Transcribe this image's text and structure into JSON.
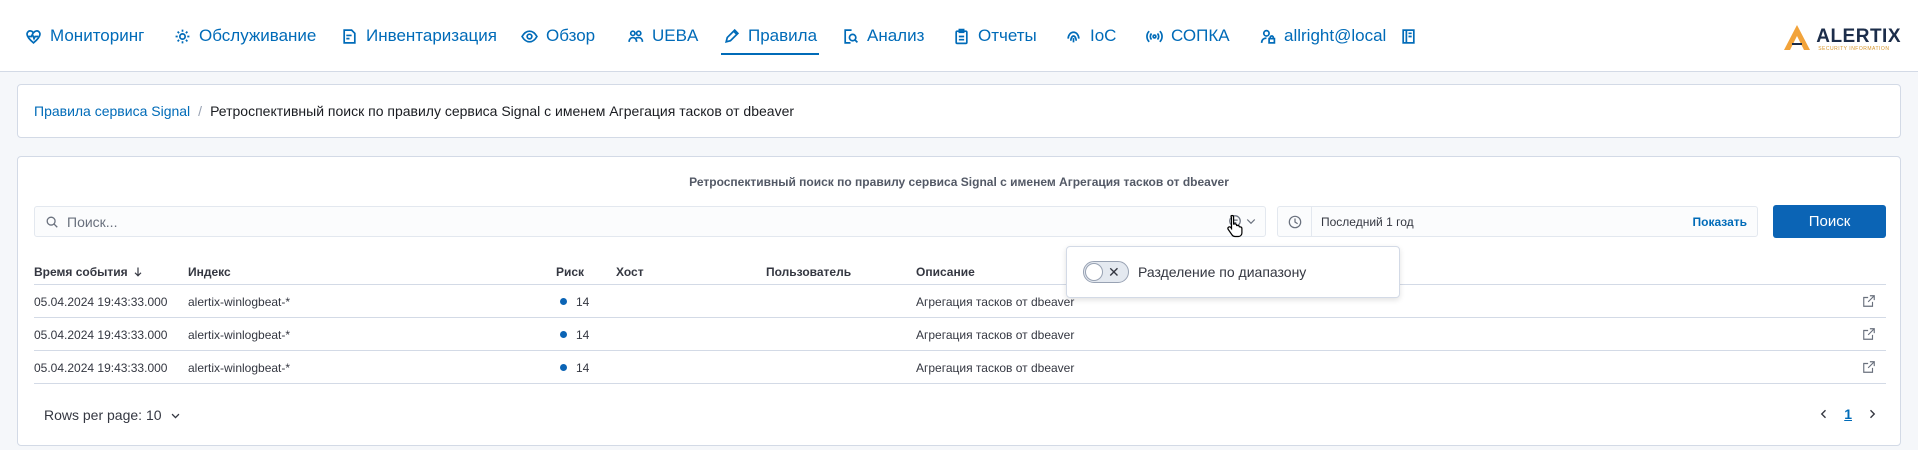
{
  "nav": {
    "items": [
      {
        "label": "Мониторинг",
        "icon": "heart-pulse-icon"
      },
      {
        "label": "Обслуживание",
        "icon": "gear-icon"
      },
      {
        "label": "Инвентаризация",
        "icon": "edit-document-icon"
      },
      {
        "label": "Обзор",
        "icon": "eye-icon"
      },
      {
        "label": "UEBA",
        "icon": "users-icon"
      },
      {
        "label": "Правила",
        "icon": "pencil-icon",
        "active": true
      },
      {
        "label": "Анализ",
        "icon": "magnifier-document-icon"
      },
      {
        "label": "Отчеты",
        "icon": "clipboard-icon"
      },
      {
        "label": "IoC",
        "icon": "fingerprint-icon"
      },
      {
        "label": "СОПКА",
        "icon": "broadcast-icon"
      },
      {
        "label": "allright@local",
        "icon": "user-lock-icon"
      }
    ],
    "extra_icon": "book-icon",
    "accent_color": "#006bb8"
  },
  "logo": {
    "text": "ALERTIX",
    "subtext": "SECURITY INFORMATION"
  },
  "breadcrumb": {
    "link": "Правила сервиса Signal",
    "current": "Ретроспективный поиск по правилу сервиса Signal с именем Агрегация тасков от dbeaver"
  },
  "card": {
    "title": "Ретроспективный поиск по правилу сервиса Signal с именем Агрегация тасков от dbeaver"
  },
  "search": {
    "placeholder": "Поиск...",
    "value": ""
  },
  "time": {
    "label": "Последний 1 год",
    "show_label": "Показать"
  },
  "search_button": {
    "label": "Поиск",
    "color": "#0b64b5"
  },
  "table": {
    "columns": [
      "Время события",
      "Индекс",
      "Риск",
      "Хост",
      "Пользователь",
      "Описание"
    ],
    "rows": [
      {
        "time": "05.04.2024 19:43:33.000",
        "index": "alertix-winlogbeat-*",
        "risk": "14",
        "host": "",
        "user": "",
        "description": "Агрегация тасков от dbeaver"
      },
      {
        "time": "05.04.2024 19:43:33.000",
        "index": "alertix-winlogbeat-*",
        "risk": "14",
        "host": "",
        "user": "",
        "description": "Агрегация тасков от dbeaver"
      },
      {
        "time": "05.04.2024 19:43:33.000",
        "index": "alertix-winlogbeat-*",
        "risk": "14",
        "host": "",
        "user": "",
        "description": "Агрегация тасков от dbeaver"
      }
    ]
  },
  "pagination": {
    "rows_per_page": "Rows per page: 10",
    "current_page": "1"
  },
  "popover": {
    "toggle_label": "Разделение по диапазону",
    "toggle_on": false
  }
}
